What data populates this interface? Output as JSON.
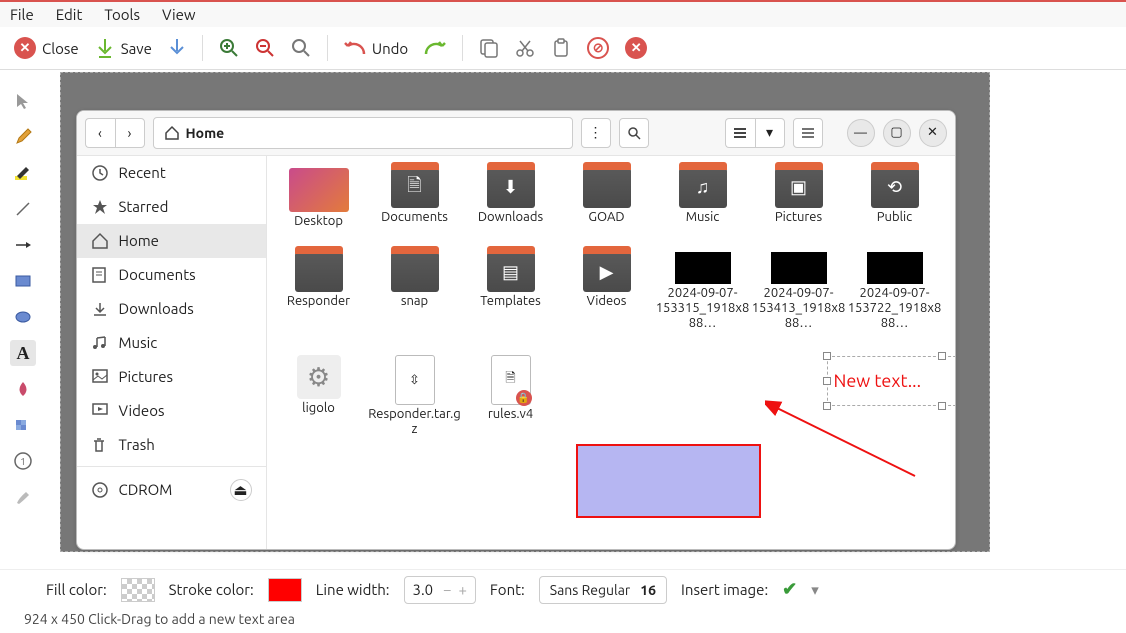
{
  "menubar": [
    "File",
    "Edit",
    "Tools",
    "View"
  ],
  "toolbar": {
    "close": "Close",
    "save": "Save",
    "undo": "Undo"
  },
  "file_manager": {
    "path_label": "Home",
    "sidebar": [
      {
        "icon": "recent",
        "label": "Recent"
      },
      {
        "icon": "star",
        "label": "Starred"
      },
      {
        "icon": "home",
        "label": "Home",
        "active": true
      },
      {
        "icon": "documents",
        "label": "Documents"
      },
      {
        "icon": "downloads",
        "label": "Downloads"
      },
      {
        "icon": "music",
        "label": "Music"
      },
      {
        "icon": "pictures",
        "label": "Pictures"
      },
      {
        "icon": "videos",
        "label": "Videos"
      },
      {
        "icon": "trash",
        "label": "Trash"
      },
      {
        "icon": "disc",
        "label": "CDROM",
        "eject": true
      }
    ],
    "items": [
      {
        "type": "grad",
        "label": "Desktop"
      },
      {
        "type": "folder",
        "glyph": "doc",
        "label": "Documents"
      },
      {
        "type": "folder",
        "glyph": "down",
        "label": "Downloads"
      },
      {
        "type": "folder",
        "glyph": "",
        "label": "GOAD"
      },
      {
        "type": "folder",
        "glyph": "music",
        "label": "Music"
      },
      {
        "type": "folder",
        "glyph": "pic",
        "label": "Pictures"
      },
      {
        "type": "folder",
        "glyph": "share",
        "label": "Public"
      },
      {
        "type": "folder",
        "glyph": "",
        "label": "Responder"
      },
      {
        "type": "folder",
        "glyph": "",
        "label": "snap"
      },
      {
        "type": "folder",
        "glyph": "tmpl",
        "label": "Templates"
      },
      {
        "type": "folder",
        "glyph": "vid",
        "label": "Videos"
      },
      {
        "type": "thumb",
        "label": "2024-09-07-153315_1918x888…"
      },
      {
        "type": "thumb",
        "label": "2024-09-07-153413_1918x888…"
      },
      {
        "type": "thumb",
        "label": "2024-09-07-153722_1918x888…"
      },
      {
        "type": "gear",
        "label": "ligolo"
      },
      {
        "type": "archive",
        "label": "Responder.tar.gz"
      },
      {
        "type": "doc-lock",
        "label": "rules.v4"
      }
    ]
  },
  "annotation_text": "New text...",
  "bottom": {
    "fill_label": "Fill color:",
    "stroke_label": "Stroke color:",
    "stroke_color": "#ff0000",
    "linewidth_label": "Line width:",
    "linewidth_value": "3.0",
    "font_label": "Font:",
    "font_value": "Sans Regular",
    "font_size": "16",
    "insert_label": "Insert image:"
  },
  "status": "924 x 450 Click-Drag to add a new text area"
}
